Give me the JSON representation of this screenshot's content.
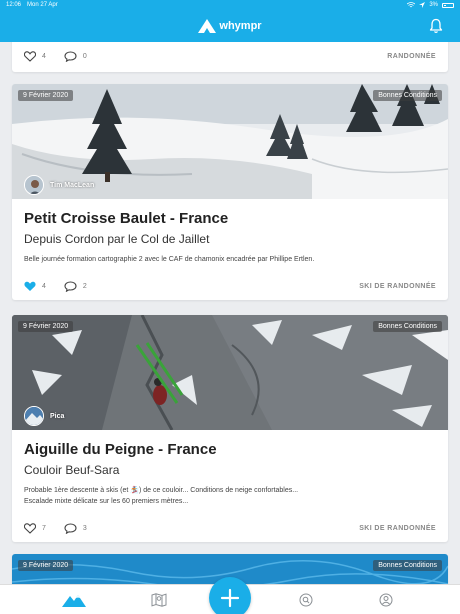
{
  "status_bar": {
    "time": "12:06",
    "date": "Mon 27 Apr",
    "battery": "3%"
  },
  "header": {
    "app_name": "whympr",
    "bell_icon": "bell-icon"
  },
  "posts": [
    {
      "likes": "4",
      "comments": "0",
      "category": "RANDONNÉE"
    },
    {
      "date": "9 Février 2020",
      "conditions": "Bonnes Conditions",
      "author": "Tim MacLean",
      "title": "Petit Croisse Baulet - France",
      "subtitle": "Depuis Cordon par le Col de Jaillet",
      "description": "Belle journée formation cartographie 2 avec le CAF de chamonix encadrée par Phillipe Ertlen.",
      "likes": "4",
      "liked": true,
      "comments": "2",
      "category": "SKI DE RANDONNÉE"
    },
    {
      "date": "9 Février 2020",
      "conditions": "Bonnes Conditions",
      "author": "Pica",
      "title": "Aiguille du Peigne - France",
      "subtitle": "Couloir Beuf-Sara",
      "description_line1": "Probable 1ère descente à skis (et 🏂) de ce couloir... Conditions de neige confortables...",
      "description_line2": "Escalade mixte délicate sur les 60 premiers mètres...",
      "likes": "7",
      "comments": "3",
      "category": "SKI DE RANDONNÉE"
    },
    {
      "date": "9 Février 2020",
      "conditions": "Bonnes Conditions"
    }
  ],
  "tabbar": {
    "tabs": [
      "mountain-icon",
      "map-icon",
      "add-icon",
      "search-icon",
      "profile-icon"
    ]
  },
  "colors": {
    "brand": "#1aaee8",
    "like_active": "#1aaee8"
  }
}
